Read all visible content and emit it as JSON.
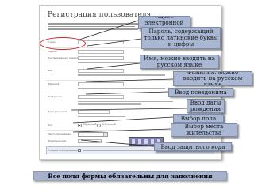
{
  "form": {
    "title": "Регистрация пользователя",
    "fields": [
      {
        "label": "E-mail"
      },
      {
        "label": "Пароль"
      },
      {
        "label": "Подтверждение пароля"
      },
      {
        "label": "Имя"
      },
      {
        "label": "Фамилия"
      },
      {
        "label": "Псевдоним"
      },
      {
        "label": "Дата рождения"
      },
      {
        "label": "Пол"
      },
      {
        "label": "Место проживания"
      },
      {
        "label": "Защитный код"
      },
      {
        "label": "Условия использования"
      }
    ],
    "gender_options": [
      "Мужской",
      "Женский"
    ]
  },
  "callouts": {
    "email": "Адрес электронной почты",
    "password": "Пароль, содержащий только латинские буквы и цифры",
    "name": "Имя, можно вводить на русском языке",
    "surname": "Фамилия, можно вводить на русском языке",
    "nickname": "Ввод псевдонима",
    "birthdate": "Ввод даты рождения",
    "gender": "Выбор пола",
    "residence": "Выбор места жительства",
    "captcha": "Ввод защитного кода"
  },
  "banner": "Все поля формы обязательны для заполнения",
  "colors": {
    "callout_bg": "#a9b7d3",
    "banner_bg": "#a6b1cc",
    "highlight": "#d21f1f"
  }
}
